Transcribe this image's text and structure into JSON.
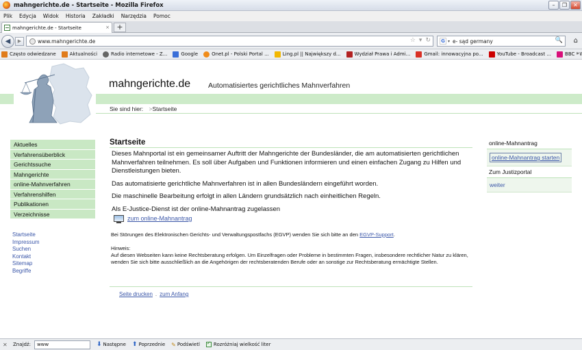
{
  "window": {
    "title": "mahngerichte.de - Startseite - Mozilla Firefox",
    "minimize": "–",
    "restore": "❐",
    "close": "✕"
  },
  "menu": [
    "Plik",
    "Edycja",
    "Widok",
    "Historia",
    "Zakładki",
    "Narzędzia",
    "Pomoc"
  ],
  "tab": {
    "label": "mahngerichte.de - Startseite",
    "close": "×",
    "new_tab": "+"
  },
  "nav": {
    "back": "◀",
    "forward": "▶",
    "url": "www.mahngerichte.de",
    "search_engine": "G",
    "search_text": "e- sąd germany",
    "search_icon": "🔍",
    "home_icon": "⌂"
  },
  "bookmarks": [
    {
      "label": "Często odwiedzane",
      "color": "#e07b1a"
    },
    {
      "label": "Aktualności",
      "color": "#e07b1a"
    },
    {
      "label": "Radio internetowe - Z...",
      "color": "#666666"
    },
    {
      "label": "Google",
      "color": "#3b6fd8"
    },
    {
      "label": "Onet.pl - Polski Portal ...",
      "color": "#f08c1a"
    },
    {
      "label": "Ling.pl || Największy d...",
      "color": "#f2b700"
    },
    {
      "label": "Wydział Prawa i Admi...",
      "color": "#b22222"
    },
    {
      "label": "Gmail: innowacyjna po...",
      "color": "#d93025"
    },
    {
      "label": "YouTube - Broadcast ...",
      "color": "#cc0000"
    },
    {
      "label": "BBC - World Service - ...",
      "color": "#d8107a"
    }
  ],
  "bookmarks_more": "»",
  "site": {
    "title": "mahngerichte.de",
    "subtitle": "Automatisiertes gerichtliches Mahnverfahren",
    "breadcrumb_prefix": "Sie sind hier:",
    "breadcrumb_sep": ">",
    "breadcrumb_current": "Startseite"
  },
  "left_nav": [
    "Aktuelles",
    "Verfahrensüberblick",
    "Gerichtssuche",
    "Mahngerichte",
    "online-Mahnverfahren",
    "Verfahrenshilfen",
    "Publikationen",
    "Verzeichnisse"
  ],
  "left_links": [
    "Startseite",
    "Impressum",
    "Suchen",
    "Kontakt",
    "Sitemap",
    "Begriffe"
  ],
  "main": {
    "heading": "Startseite",
    "para1": "Dieses Mahnportal ist ein gemeinsamer Auftritt der Mahngerichte der Bundesländer, die am automatisierten gerichtlichen Mahnverfahren teilnehmen. Es soll über Aufgaben und Funktionen informieren und einen einfachen Zugang zu Hilfen und Dienstleistungen bieten.",
    "para2": "Das automatisierte gerichtliche Mahnverfahren ist in allen Bundesländern eingeführt worden.",
    "para3": "Die maschinelle Bearbeitung erfolgt in allen Ländern grundsätzlich nach einheitlichen Regeln.",
    "para4": "Als E-Justice-Dienst ist der online-Mahnantrag zugelassen",
    "ejustice_link": "zum online-Mahnantrag",
    "egvp_text": "Bei Störungen des Elektronischen Gerichts- und Verwaltungspostfachs (EGVP) wenden Sie sich bitte an den",
    "egvp_link": "EGVP-Support",
    "egvp_end": ".",
    "hint_title": "Hinweis:",
    "hint_text": "Auf diesen Webseiten kann keine Rechtsberatung erfolgen. Um Einzelfragen oder Probleme in bestimmten Fragen, insbesondere rechtlicher Natur zu klären, wenden Sie sich bitte ausschließlich an die Angehörigen der rechtsberatenden Berufe oder an sonstige zur Rechtsberatung ermächtigte Stellen.",
    "print_link": "Seite drucken",
    "top_link": "zum Anfang",
    "dot": "."
  },
  "right": {
    "box1_head": "online-Mahnantrag",
    "box1_link": "online-Mahnantrag starten",
    "box2_head": "Zum Justizportal",
    "box2_link": "weiter"
  },
  "findbar": {
    "close": "✕",
    "label": "Znajdź:",
    "value": "www",
    "next": "Następne",
    "prev": "Poprzednie",
    "highlight": "Podświetl",
    "match_case": "Rozróżniaj wielkość liter"
  }
}
